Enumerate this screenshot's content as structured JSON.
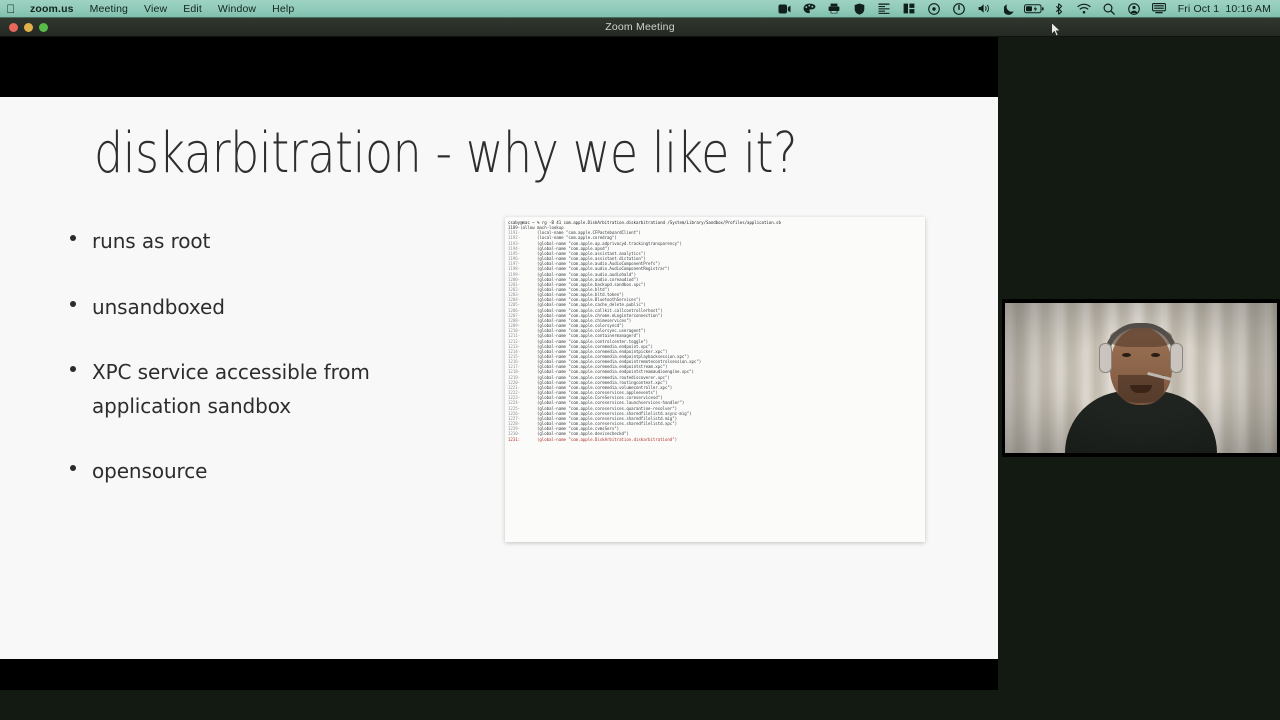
{
  "menubar": {
    "apple_glyph": "apple-logo",
    "items": [
      {
        "label": "zoom.us",
        "name": "menu-zoom-us",
        "bold": true
      },
      {
        "label": "Meeting",
        "name": "menu-meeting",
        "bold": false
      },
      {
        "label": "View",
        "name": "menu-view",
        "bold": false
      },
      {
        "label": "Edit",
        "name": "menu-edit",
        "bold": false
      },
      {
        "label": "Window",
        "name": "menu-window",
        "bold": false
      },
      {
        "label": "Help",
        "name": "menu-help",
        "bold": false
      }
    ],
    "status_icons": [
      "screen-recording-icon",
      "paint-palette-icon",
      "printer-icon",
      "shield-icon",
      "text-tool-icon",
      "stats-icon",
      "record-dot-icon",
      "power-icon",
      "volume-icon",
      "do-not-disturb-moon-icon",
      "battery-icon",
      "bluetooth-icon",
      "wifi-icon",
      "spotlight-search-icon",
      "user-account-icon",
      "display-icon"
    ],
    "clock": "Fri Oct 1  10:16 AM",
    "bar_color": "#8fc9b8"
  },
  "window": {
    "title": "Zoom Meeting",
    "traffic_lights": [
      "close",
      "minimize",
      "zoom"
    ]
  },
  "slide": {
    "watermark": "",
    "title": "diskarbitration - why we like it?",
    "bullets": [
      "runs as root",
      "unsandboxed",
      "XPC service accessible from application sandbox",
      "opensource"
    ],
    "background": "#f7f8f7",
    "text_color": "#2d2d2d"
  },
  "terminal": {
    "prompt": "csaby@mac ~ % rg -B 41 com.apple.DiskArbitration.diskarbitrationd /System/Library/Sandbox/Profiles/application.sb",
    "header": "1189-(allow mach-lookup",
    "highlight_color": "#b4332c",
    "lines": [
      {
        "n": "1191-",
        "t": "       (local-name \"com.apple.CFPasteboardClient\")"
      },
      {
        "n": "1192-",
        "t": "       (local-name \"com.apple.coredrag\")"
      },
      {
        "n": "1193-",
        "t": "       (global-name \"com.apple.ap.adprivacyd.trackingtransparency\")"
      },
      {
        "n": "1194-",
        "t": "       (global-name \"com.apple.apsd\")"
      },
      {
        "n": "1195-",
        "t": "       (global-name \"com.apple.assistant.analytics\")"
      },
      {
        "n": "1196-",
        "t": "       (global-name \"com.apple.assistant.dictation\")"
      },
      {
        "n": "1197-",
        "t": "       (global-name \"com.apple.audio.AudioComponentPrefs\")"
      },
      {
        "n": "1198-",
        "t": "       (global-name \"com.apple.audio.AudioComponentRegistrar\")"
      },
      {
        "n": "1199-",
        "t": "       (global-name \"com.apple.audio.audiohald\")"
      },
      {
        "n": "1200-",
        "t": "       (global-name \"com.apple.audio.coreaudiod\")"
      },
      {
        "n": "1201-",
        "t": "       (global-name \"com.apple.backupd.sandbox.xpc\")"
      },
      {
        "n": "1202-",
        "t": "       (global-name \"com.apple.bltd\")"
      },
      {
        "n": "1203-",
        "t": "       (global-name \"com.apple.bltd.token\")"
      },
      {
        "n": "1204-",
        "t": "       (global-name \"com.apple.BluetoothServices\")"
      },
      {
        "n": "1205-",
        "t": "       (global-name \"com.apple.cache_delete.public\")"
      },
      {
        "n": "1206-",
        "t": "       (global-name \"com.apple.callkit.callcontrollerhost\")"
      },
      {
        "n": "1207-",
        "t": "       (global-name \"com.apple.chrome.eLoginterconnection\")"
      },
      {
        "n": "1208-",
        "t": "       (global-name \"com.apple.chimeservices\")"
      },
      {
        "n": "1209-",
        "t": "       (global-name \"com.apple.colorsyncd\")"
      },
      {
        "n": "1210-",
        "t": "       (global-name \"com.apple.colorsync.useragent\")"
      },
      {
        "n": "1211-",
        "t": "       (global-name \"com.apple.containermanagerd\")"
      },
      {
        "n": "1212-",
        "t": "       (global-name \"com.apple.controlcenter.toggle\")"
      },
      {
        "n": "1213-",
        "t": "       (global-name \"com.apple.coremedia.endpoint.xpc\")"
      },
      {
        "n": "1214-",
        "t": "       (global-name \"com.apple.coremedia.endpointpicker.xpc\")"
      },
      {
        "n": "1215-",
        "t": "       (global-name \"com.apple.coremedia.endpointplaybacksession.xpc\")"
      },
      {
        "n": "1216-",
        "t": "       (global-name \"com.apple.coremedia.endpointremotecontrolsession.xpc\")"
      },
      {
        "n": "1217-",
        "t": "       (global-name \"com.apple.coremedia.endpointstream.xpc\")"
      },
      {
        "n": "1218-",
        "t": "       (global-name \"com.apple.coremedia.endpointstreamaudioengine.xpc\")"
      },
      {
        "n": "1219-",
        "t": "       (global-name \"com.apple.coremedia.routediscoverer.xpc\")"
      },
      {
        "n": "1220-",
        "t": "       (global-name \"com.apple.coremedia.routingcontext.xpc\")"
      },
      {
        "n": "1221-",
        "t": "       (global-name \"com.apple.coremedia.volumecontroller.xpc\")"
      },
      {
        "n": "1222-",
        "t": "       (global-name \"com.apple.coreservices.appleevents\")"
      },
      {
        "n": "1223-",
        "t": "       (global-name \"com.apple.CoreServices.coreservicesd\")"
      },
      {
        "n": "1224-",
        "t": "       (global-name \"com.apple.coreservices.launchservices-handler\")"
      },
      {
        "n": "1225-",
        "t": "       (global-name \"com.apple.coreservices.quarantine-resolver\")"
      },
      {
        "n": "1226-",
        "t": "       (global-name \"com.apple.coreservices.sharedfilelistd.async-mig\")"
      },
      {
        "n": "1227-",
        "t": "       (global-name \"com.apple.coreservices.sharedfilelistd.mig\")"
      },
      {
        "n": "1228-",
        "t": "       (global-name \"com.apple.coreservices.sharedfilelistd.xpc\")"
      },
      {
        "n": "1229-",
        "t": "       (global-name \"com.apple.cvmsServ\")"
      },
      {
        "n": "1230-",
        "t": "       (global-name \"com.apple.devicecheckd\")"
      },
      {
        "n": "1231:",
        "t": "       (global-name \"com.apple.DiskArbitration.diskarbitrationd\")",
        "hl": true
      }
    ]
  },
  "webcam": {
    "participant": "video-participant",
    "has_headphones": true
  }
}
